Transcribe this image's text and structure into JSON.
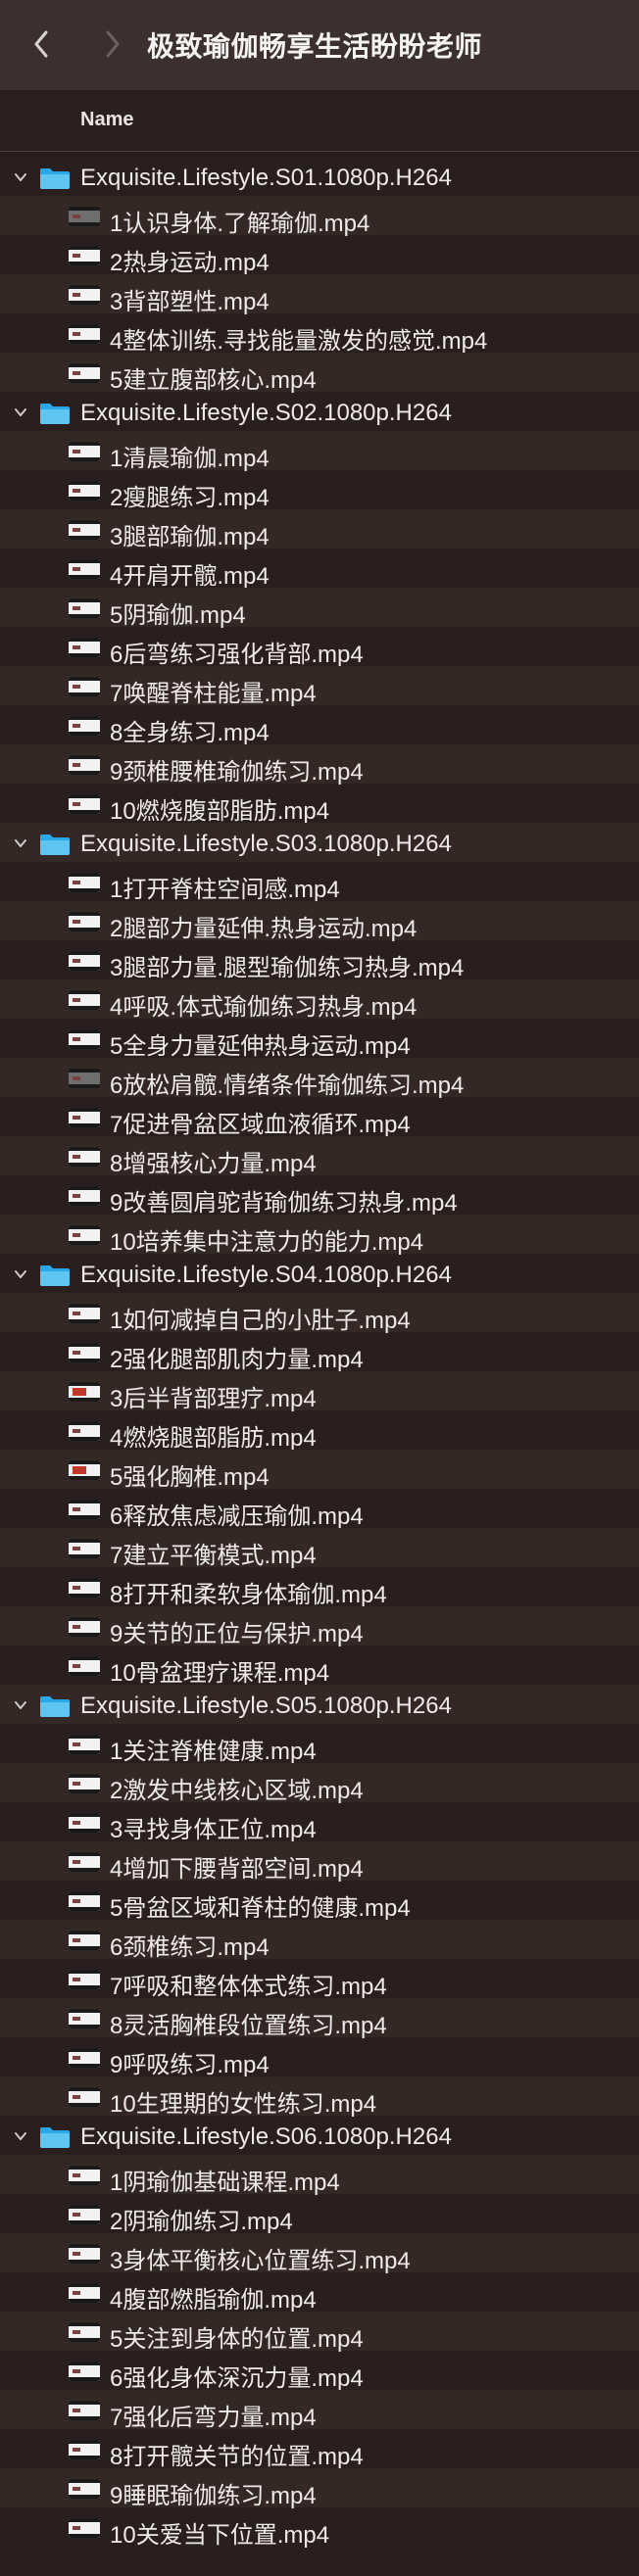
{
  "window": {
    "title": "极致瑜伽畅享生活盼盼老师"
  },
  "header": {
    "name_col": "Name"
  },
  "colors": {
    "background": "#2a1f1f",
    "titlebar": "#3b302f",
    "alt_row": "#342827",
    "folder": "#29a9e9"
  },
  "tree": [
    {
      "type": "folder",
      "name": "Exquisite.Lifestyle.S01.1080p.H264"
    },
    {
      "type": "file",
      "name": "1认识身体.了解瑜伽.mp4",
      "thumb": "dark"
    },
    {
      "type": "file",
      "name": "2热身运动.mp4"
    },
    {
      "type": "file",
      "name": "3背部塑性.mp4"
    },
    {
      "type": "file",
      "name": "4整体训练.寻找能量激发的感觉.mp4"
    },
    {
      "type": "file",
      "name": "5建立腹部核心.mp4"
    },
    {
      "type": "folder",
      "name": "Exquisite.Lifestyle.S02.1080p.H264"
    },
    {
      "type": "file",
      "name": "1清晨瑜伽.mp4"
    },
    {
      "type": "file",
      "name": "2瘦腿练习.mp4"
    },
    {
      "type": "file",
      "name": "3腿部瑜伽.mp4"
    },
    {
      "type": "file",
      "name": "4开肩开髋.mp4"
    },
    {
      "type": "file",
      "name": "5阴瑜伽.mp4"
    },
    {
      "type": "file",
      "name": "6后弯练习强化背部.mp4"
    },
    {
      "type": "file",
      "name": "7唤醒脊柱能量.mp4"
    },
    {
      "type": "file",
      "name": "8全身练习.mp4"
    },
    {
      "type": "file",
      "name": "9颈椎腰椎瑜伽练习.mp4"
    },
    {
      "type": "file",
      "name": "10燃烧腹部脂肪.mp4"
    },
    {
      "type": "folder",
      "name": "Exquisite.Lifestyle.S03.1080p.H264"
    },
    {
      "type": "file",
      "name": "1打开脊柱空间感.mp4"
    },
    {
      "type": "file",
      "name": "2腿部力量延伸.热身运动.mp4"
    },
    {
      "type": "file",
      "name": "3腿部力量.腿型瑜伽练习热身.mp4"
    },
    {
      "type": "file",
      "name": "4呼吸.体式瑜伽练习热身.mp4"
    },
    {
      "type": "file",
      "name": "5全身力量延伸热身运动.mp4"
    },
    {
      "type": "file",
      "name": "6放松肩髋.情绪条件瑜伽练习.mp4",
      "thumb": "dark"
    },
    {
      "type": "file",
      "name": "7促进骨盆区域血液循环.mp4"
    },
    {
      "type": "file",
      "name": "8增强核心力量.mp4"
    },
    {
      "type": "file",
      "name": "9改善圆肩驼背瑜伽练习热身.mp4"
    },
    {
      "type": "file",
      "name": "10培养集中注意力的能力.mp4"
    },
    {
      "type": "folder",
      "name": "Exquisite.Lifestyle.S04.1080p.H264"
    },
    {
      "type": "file",
      "name": "1如何减掉自己的小肚子.mp4"
    },
    {
      "type": "file",
      "name": "2强化腿部肌肉力量.mp4"
    },
    {
      "type": "file",
      "name": "3后半背部理疗.mp4",
      "thumb": "flag"
    },
    {
      "type": "file",
      "name": "4燃烧腿部脂肪.mp4"
    },
    {
      "type": "file",
      "name": "5强化胸椎.mp4",
      "thumb": "flag"
    },
    {
      "type": "file",
      "name": "6释放焦虑减压瑜伽.mp4"
    },
    {
      "type": "file",
      "name": "7建立平衡模式.mp4"
    },
    {
      "type": "file",
      "name": "8打开和柔软身体瑜伽.mp4"
    },
    {
      "type": "file",
      "name": "9关节的正位与保护.mp4"
    },
    {
      "type": "file",
      "name": "10骨盆理疗课程.mp4"
    },
    {
      "type": "folder",
      "name": "Exquisite.Lifestyle.S05.1080p.H264"
    },
    {
      "type": "file",
      "name": "1关注脊椎健康.mp4"
    },
    {
      "type": "file",
      "name": "2激发中线核心区域.mp4"
    },
    {
      "type": "file",
      "name": "3寻找身体正位.mp4"
    },
    {
      "type": "file",
      "name": "4增加下腰背部空间.mp4"
    },
    {
      "type": "file",
      "name": "5骨盆区域和脊柱的健康.mp4"
    },
    {
      "type": "file",
      "name": "6颈椎练习.mp4"
    },
    {
      "type": "file",
      "name": "7呼吸和整体体式练习.mp4"
    },
    {
      "type": "file",
      "name": "8灵活胸椎段位置练习.mp4"
    },
    {
      "type": "file",
      "name": "9呼吸练习.mp4"
    },
    {
      "type": "file",
      "name": "10生理期的女性练习.mp4"
    },
    {
      "type": "folder",
      "name": "Exquisite.Lifestyle.S06.1080p.H264"
    },
    {
      "type": "file",
      "name": "1阴瑜伽基础课程.mp4"
    },
    {
      "type": "file",
      "name": "2阴瑜伽练习.mp4"
    },
    {
      "type": "file",
      "name": "3身体平衡核心位置练习.mp4"
    },
    {
      "type": "file",
      "name": "4腹部燃脂瑜伽.mp4"
    },
    {
      "type": "file",
      "name": "5关注到身体的位置.mp4"
    },
    {
      "type": "file",
      "name": "6强化身体深沉力量.mp4"
    },
    {
      "type": "file",
      "name": "7强化后弯力量.mp4"
    },
    {
      "type": "file",
      "name": "8打开髋关节的位置.mp4"
    },
    {
      "type": "file",
      "name": "9睡眠瑜伽练习.mp4"
    },
    {
      "type": "file",
      "name": "10关爱当下位置.mp4"
    }
  ]
}
